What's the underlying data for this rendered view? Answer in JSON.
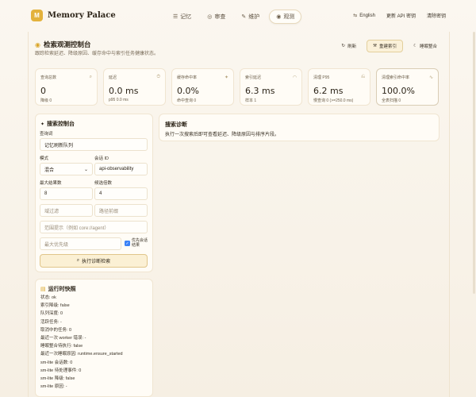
{
  "brand": {
    "logo": "M",
    "name": "Memory Palace"
  },
  "nav": [
    {
      "label": "记忆",
      "icon": "☰"
    },
    {
      "label": "审查",
      "icon": "◎"
    },
    {
      "label": "维护",
      "icon": "✎"
    },
    {
      "label": "观测",
      "icon": "◉"
    }
  ],
  "top_actions": {
    "language": "English",
    "update_key": "更新 API 密钥",
    "clear_key": "清除密钥"
  },
  "header": {
    "title": "检索观测控制台",
    "subtitle": "跟踪检索延迟、降级原因、缓存命中与索引任务健康状态。",
    "refresh": "刷新",
    "rebuild": "重建索引",
    "sleep": "睡眠整合"
  },
  "stats": [
    {
      "label": "查询总数",
      "value": "0",
      "sub": "降级 0",
      "icon": "⌕"
    },
    {
      "label": "延迟",
      "value": "0.0 ms",
      "sub": "p95 0.0 ms",
      "icon": "⏱"
    },
    {
      "label": "缓存命中率",
      "value": "0.0%",
      "sub": "命中查询 0",
      "icon": "✦"
    },
    {
      "label": "索引延迟",
      "value": "6.3 ms",
      "sub": "样本 1",
      "icon": "◠"
    },
    {
      "label": "清理 P95",
      "value": "6.2 ms",
      "sub": "慢查询 0 (>=250.0 ms)",
      "icon": "⎌"
    },
    {
      "label": "清理索引命中率",
      "value": "100.0%",
      "sub": "全表扫描 0",
      "icon": "∿"
    }
  ],
  "control": {
    "title": "搜索控制台",
    "query_label": "查询词",
    "query_value": "记忆刷新队列",
    "mode_label": "模式",
    "mode_value": "混合",
    "session_label": "会话 ID",
    "session_value": "api-observability",
    "max_results_label": "最大结果数",
    "max_results_value": "8",
    "candidate_label": "候选倍数",
    "candidate_value": "4",
    "domain_placeholder": "域过滤",
    "path_placeholder": "路径前缀",
    "scope_placeholder": "范围提示（例如 core://agent）",
    "priority_placeholder": "最大优先级",
    "prefer_session_label_1": "优先会话",
    "prefer_session_label_2": "结果",
    "run_button": "执行诊断检索"
  },
  "diagnosis": {
    "title": "搜索诊断",
    "text": "执行一次搜索后即可查看延迟、降级原因与排序片段。"
  },
  "runtime": {
    "title": "运行时快照",
    "lines": [
      "状态: ok",
      "索引降级: false",
      "队列深度: 0",
      "活跃任务: -",
      "取消中的任务: 0",
      "最近一次 worker 错误: -",
      "睡眠整合待执行: false",
      "最近一次睡眠原因: runtime.ensure_started",
      "sm-lite 会话数: 0",
      "sm-lite 待处理事件: 0",
      "sm-lite 降级: false",
      "sm-lite 原因: -"
    ]
  }
}
